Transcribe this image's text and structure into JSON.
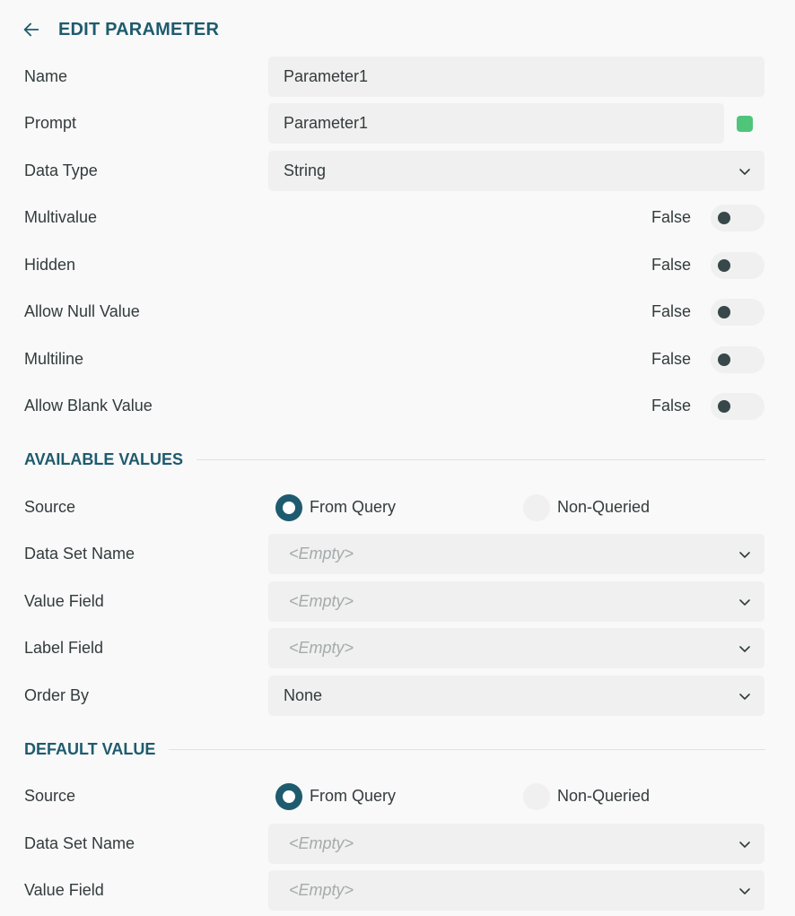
{
  "header": {
    "title": "EDIT PARAMETER",
    "back_icon": "arrow-left-icon"
  },
  "general": {
    "name": {
      "label": "Name",
      "value": "Parameter1"
    },
    "prompt": {
      "label": "Prompt",
      "value": "Parameter1",
      "indicator_color": "#4fc57a"
    },
    "data_type": {
      "label": "Data Type",
      "value": "String"
    },
    "toggles": [
      {
        "label": "Multivalue",
        "state": "False"
      },
      {
        "label": "Hidden",
        "state": "False"
      },
      {
        "label": "Allow Null Value",
        "state": "False"
      },
      {
        "label": "Multiline",
        "state": "False"
      },
      {
        "label": "Allow Blank Value",
        "state": "False"
      }
    ]
  },
  "available_values": {
    "title": "AVAILABLE VALUES",
    "source": {
      "label": "Source",
      "option_query": "From Query",
      "option_non_queried": "Non-Queried",
      "selected": "From Query"
    },
    "data_set_name": {
      "label": "Data Set Name",
      "value": "<Empty>"
    },
    "value_field": {
      "label": "Value Field",
      "value": "<Empty>"
    },
    "label_field": {
      "label": "Label Field",
      "value": "<Empty>"
    },
    "order_by": {
      "label": "Order By",
      "value": "None"
    }
  },
  "default_value": {
    "title": "DEFAULT VALUE",
    "source": {
      "label": "Source",
      "option_query": "From Query",
      "option_non_queried": "Non-Queried",
      "selected": "From Query"
    },
    "data_set_name": {
      "label": "Data Set Name",
      "value": "<Empty>"
    },
    "value_field": {
      "label": "Value Field",
      "value": "<Empty>"
    }
  },
  "colors": {
    "accent": "#1e5b6e",
    "field_bg": "#eff0ef",
    "text": "#333b3d",
    "placeholder": "#a5aaab",
    "indicator": "#4fc57a"
  }
}
